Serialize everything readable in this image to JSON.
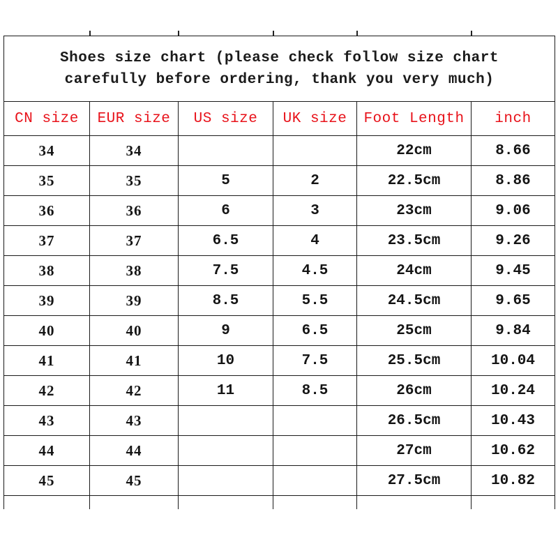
{
  "document": {
    "title_line1": "Shoes size chart (please check follow size chart",
    "title_line2": "carefully before ordering, thank you very much)",
    "header_color": "#e8121a",
    "columns": [
      "CN size",
      "EUR size",
      "US size",
      "UK size",
      "Foot Length",
      "inch"
    ],
    "rows": [
      {
        "cn": "34",
        "eur": "34",
        "us": "",
        "uk": "",
        "foot": "22cm",
        "inch": "8.66"
      },
      {
        "cn": "35",
        "eur": "35",
        "us": "5",
        "uk": "2",
        "foot": "22.5cm",
        "inch": "8.86"
      },
      {
        "cn": "36",
        "eur": "36",
        "us": "6",
        "uk": "3",
        "foot": "23cm",
        "inch": "9.06"
      },
      {
        "cn": "37",
        "eur": "37",
        "us": "6.5",
        "uk": "4",
        "foot": "23.5cm",
        "inch": "9.26"
      },
      {
        "cn": "38",
        "eur": "38",
        "us": "7.5",
        "uk": "4.5",
        "foot": "24cm",
        "inch": "9.45"
      },
      {
        "cn": "39",
        "eur": "39",
        "us": "8.5",
        "uk": "5.5",
        "foot": "24.5cm",
        "inch": "9.65"
      },
      {
        "cn": "40",
        "eur": "40",
        "us": "9",
        "uk": "6.5",
        "foot": "25cm",
        "inch": "9.84"
      },
      {
        "cn": "41",
        "eur": "41",
        "us": "10",
        "uk": "7.5",
        "foot": "25.5cm",
        "inch": "10.04"
      },
      {
        "cn": "42",
        "eur": "42",
        "us": "11",
        "uk": "8.5",
        "foot": "26cm",
        "inch": "10.24"
      },
      {
        "cn": "43",
        "eur": "43",
        "us": "",
        "uk": "",
        "foot": "26.5cm",
        "inch": "10.43"
      },
      {
        "cn": "44",
        "eur": "44",
        "us": "",
        "uk": "",
        "foot": "27cm",
        "inch": "10.62"
      },
      {
        "cn": "45",
        "eur": "45",
        "us": "",
        "uk": "",
        "foot": "27.5cm",
        "inch": "10.82"
      }
    ]
  }
}
